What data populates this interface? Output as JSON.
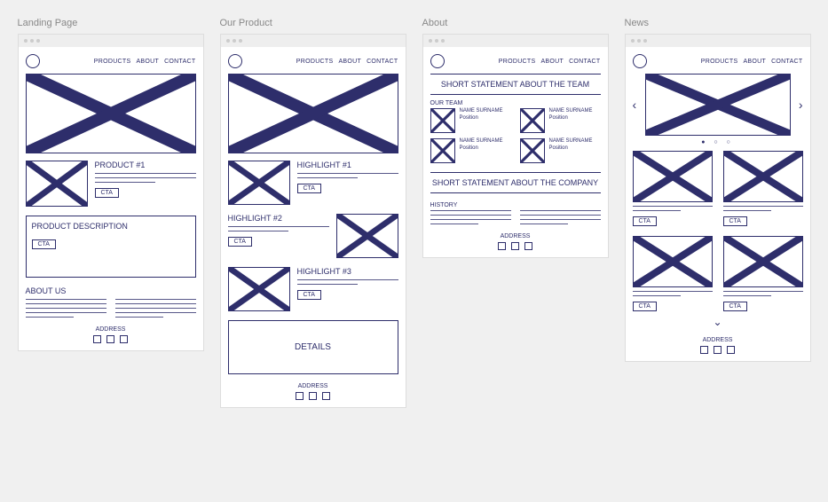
{
  "frames": {
    "landing": {
      "title": "Landing Page"
    },
    "product": {
      "title": "Our Product"
    },
    "about": {
      "title": "About"
    },
    "news": {
      "title": "News"
    }
  },
  "nav": {
    "products": "PRODUCTS",
    "about": "ABOUT",
    "contact": "CONTACT"
  },
  "cta": "CTA",
  "landing": {
    "product1": "PRODUCT #1",
    "prod_desc": "PRODUCT DESCRIPTION",
    "about_us": "ABOUT US"
  },
  "product": {
    "h1": "HIGHLIGHT #1",
    "h2": "HIGHLIGHT #2",
    "h3": "HIGHLIGHT #3",
    "details": "DETAILS"
  },
  "about": {
    "team_statement": "SHORT STATEMENT ABOUT THE TEAM",
    "our_team": "OUR TEAM",
    "member_name": "NAME SURNAME",
    "member_pos": "Position",
    "company_statement": "SHORT STATEMENT ABOUT THE COMPANY",
    "history": "HISTORY"
  },
  "footer": {
    "address": "ADDRESS"
  }
}
